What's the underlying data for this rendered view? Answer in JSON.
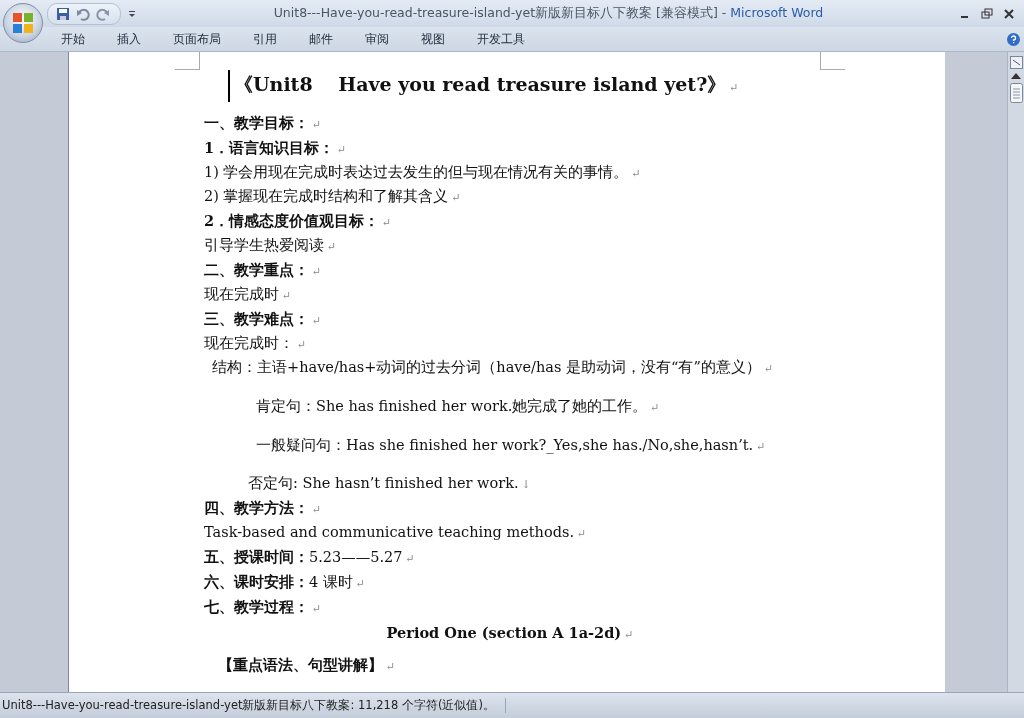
{
  "window": {
    "title": "Unit8---Have-you-read-treasure-island-yet新版新目标八下教案 [兼容模式]",
    "separator": "-",
    "app": "Microsoft Word"
  },
  "ribbon_tabs": [
    {
      "label": "开始",
      "selected": false
    },
    {
      "label": "插入",
      "selected": false
    },
    {
      "label": "页面布局",
      "selected": false
    },
    {
      "label": "引用",
      "selected": false
    },
    {
      "label": "邮件",
      "selected": false
    },
    {
      "label": "审阅",
      "selected": false
    },
    {
      "label": "视图",
      "selected": false
    },
    {
      "label": "开发工具",
      "selected": false
    }
  ],
  "document": {
    "paragraphs": [
      {
        "kind": "title",
        "text": "《Unit8　 Have you read treasure island yet?》",
        "end": "↵"
      },
      {
        "kind": "heading",
        "text": "一、教学目标：",
        "end": "↵"
      },
      {
        "kind": "heading",
        "text": "1．语言知识目标：",
        "end": "↵"
      },
      {
        "kind": "body",
        "text": "1) 学会用现在完成时表达过去发生的但与现在情况有关的事情。",
        "end": "↵"
      },
      {
        "kind": "body",
        "text": "2) 掌握现在完成时结构和了解其含义",
        "end": "↵"
      },
      {
        "kind": "heading",
        "text": "2．情感态度价值观目标：",
        "end": "↵"
      },
      {
        "kind": "body",
        "text": "引导学生热爱阅读",
        "end": "↵"
      },
      {
        "kind": "heading",
        "text": "二、教学重点：",
        "end": "↵"
      },
      {
        "kind": "body",
        "text": "现在完成时",
        "end": "↵"
      },
      {
        "kind": "heading",
        "text": "三、教学难点：",
        "end": "↵"
      },
      {
        "kind": "body",
        "text": "现在完成时：",
        "end": "↵"
      },
      {
        "kind": "structure",
        "text": "结构：主语+have/has+动词的过去分词（have/has 是助动词，没有“有”的意义）",
        "end": "↵"
      },
      {
        "kind": "example",
        "text": "肯定句：She has finished her work.她完成了她的工作。",
        "end": "↵"
      },
      {
        "kind": "example",
        "text": "一般疑问句：Has she finished her work?_Yes,she has./No,she,hasn’t.",
        "end": "↵"
      },
      {
        "kind": "negative",
        "text": "否定句: She hasn’t finished her work.",
        "end": "↓"
      },
      {
        "kind": "heading",
        "text": "四、教学方法：",
        "end": "↵"
      },
      {
        "kind": "body",
        "text": "Task-based and communicative teaching methods.",
        "end": "↵"
      },
      {
        "kind": "mixed",
        "label": "五、授课时间：",
        "text": "5.23——5.27",
        "end": "↵"
      },
      {
        "kind": "mixed",
        "label": "六、课时安排：",
        "text": "4 课时",
        "end": "↵"
      },
      {
        "kind": "heading",
        "text": "七、教学过程：",
        "end": "↵"
      },
      {
        "kind": "center",
        "text": "Period One (section A 1a-2d)",
        "end": "↵"
      },
      {
        "kind": "section",
        "text": "【重点语法、句型讲解】",
        "end": "↵"
      }
    ]
  },
  "status_bar": {
    "text": "Unit8---Have-you-read-treasure-island-yet新版新目标八下教案: 11,218 个字符(近似值)。"
  }
}
